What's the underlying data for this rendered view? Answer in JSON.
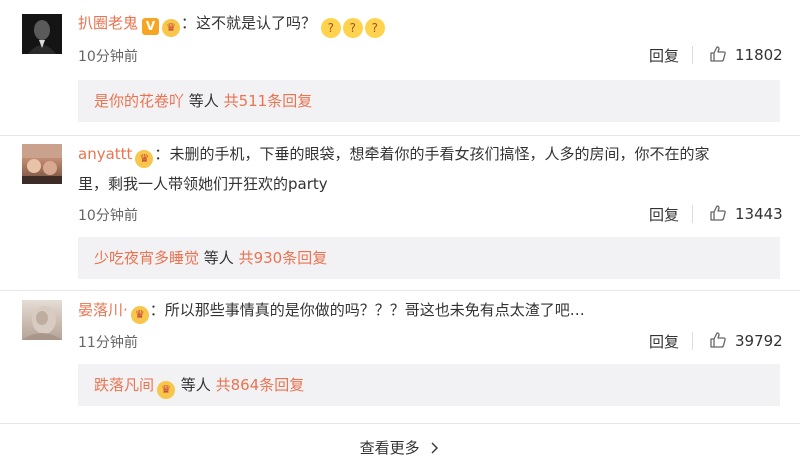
{
  "comments": [
    {
      "username": "扒圈老鬼",
      "verified_badge": "V",
      "colon": "：",
      "text": "这不就是认了吗？",
      "emojis": [
        "?",
        "?",
        "?"
      ],
      "time": "10分钟前",
      "reply_label": "回复",
      "likes": "11802",
      "sub": {
        "name": "是你的花卷吖",
        "etc": "等人",
        "count": "共511条回复"
      }
    },
    {
      "username": "anyattt",
      "colon": "：",
      "text_line1": "未删的手机，下垂的眼袋，想牵着你的手看女孩们搞怪，人多的房间，你不在的家",
      "text_line2": "里，剩我一人带领她们开狂欢的party",
      "time": "10分钟前",
      "reply_label": "回复",
      "likes": "13443",
      "sub": {
        "name": "少吃夜宵多睡觉",
        "etc": "等人",
        "count": "共930条回复"
      }
    },
    {
      "username": "晏落川·",
      "colon": "：",
      "text": "所以那些事情真的是你做的吗？？？哥这也未免有点太渣了吧…",
      "time": "11分钟前",
      "reply_label": "回复",
      "likes": "39792",
      "sub": {
        "name": "跌落凡间",
        "etc": "等人",
        "count": "共864条回复"
      }
    }
  ],
  "see_more": "查看更多",
  "colors": {
    "accent": "#eb7350",
    "subbox_bg": "#f2f2f5"
  },
  "icons": {
    "like": "thumbs-up-icon",
    "member": "crown-icon",
    "more": "chevron-right-icon"
  }
}
